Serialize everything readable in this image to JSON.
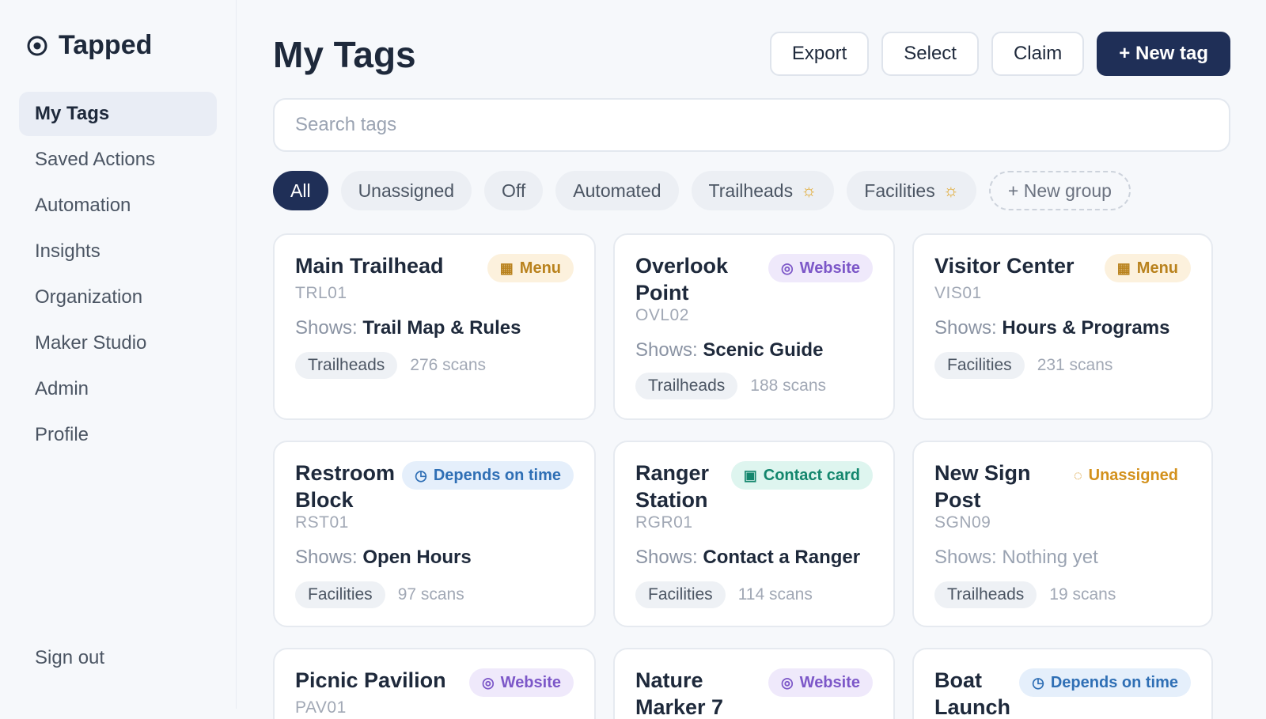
{
  "app": {
    "name": "Tapped"
  },
  "sidebar": {
    "items": [
      {
        "label": "My Tags",
        "active": true
      },
      {
        "label": "Saved Actions"
      },
      {
        "label": "Automation"
      },
      {
        "label": "Insights"
      },
      {
        "label": "Organization"
      },
      {
        "label": "Maker Studio"
      },
      {
        "label": "Admin"
      },
      {
        "label": "Profile"
      }
    ],
    "sign_out": "Sign out"
  },
  "header": {
    "title": "My Tags",
    "export": "Export",
    "select": "Select",
    "claim": "Claim",
    "new_tag": "+ New tag"
  },
  "search": {
    "placeholder": "Search tags",
    "value": ""
  },
  "filters": {
    "all": "All",
    "unassigned": "Unassigned",
    "off": "Off",
    "automated": "Automated",
    "trailheads": "Trailheads",
    "facilities": "Facilities",
    "new_group": "+ New group"
  },
  "colors": {
    "accent": "#1f2f57",
    "menu_badge": "#b9821d",
    "website_badge": "#7c57c8",
    "time_badge": "#2f6fb5",
    "contact_badge": "#13866d",
    "unassigned_badge": "#d3911c"
  },
  "tags": [
    {
      "name": "Main Trailhead",
      "badge": "Menu",
      "badge_icon": "grid-icon",
      "code": "TRL01",
      "shows_prefix": "Shows:",
      "shows": "Trail Map & Rules",
      "group": "Trailheads",
      "scans": "276 scans"
    },
    {
      "name": "Overlook Point",
      "badge": "Website",
      "badge_icon": "globe-icon",
      "code": "OVL02",
      "shows_prefix": "Shows:",
      "shows": "Scenic Guide",
      "group": "Trailheads",
      "scans": "188 scans"
    },
    {
      "name": "Visitor Center",
      "badge": "Menu",
      "badge_icon": "grid-icon",
      "code": "VIS01",
      "shows_prefix": "Shows:",
      "shows": "Hours & Programs",
      "group": "Facilities",
      "scans": "231 scans"
    },
    {
      "name": "Restroom Block",
      "badge": "Depends on time",
      "badge_icon": "clock-icon",
      "code": "RST01",
      "shows_prefix": "Shows:",
      "shows": "Open Hours",
      "group": "Facilities",
      "scans": "97 scans"
    },
    {
      "name": "Ranger Station",
      "badge": "Contact card",
      "badge_icon": "contact-card-icon",
      "code": "RGR01",
      "shows_prefix": "Shows:",
      "shows": "Contact a Ranger",
      "group": "Facilities",
      "scans": "114 scans"
    },
    {
      "name": "New Sign Post",
      "badge": "Unassigned",
      "badge_icon": "dashed-circle-icon",
      "code": "SGN09",
      "shows_empty": "Shows: Nothing yet",
      "group": "Trailheads",
      "scans": "19 scans"
    },
    {
      "name": "Picnic Pavilion",
      "badge": "Website",
      "badge_icon": "globe-icon",
      "code": "PAV01"
    },
    {
      "name": "Nature Marker 7",
      "badge": "Website",
      "badge_icon": "globe-icon"
    },
    {
      "name": "Boat Launch",
      "badge": "Depends on time",
      "badge_icon": "clock-icon"
    }
  ]
}
